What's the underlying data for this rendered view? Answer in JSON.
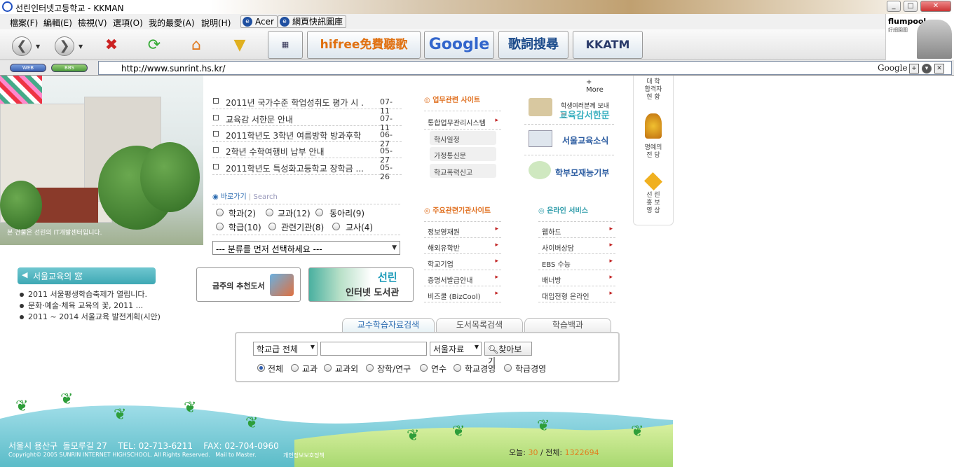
{
  "window": {
    "title": "선린인터넷고등학교 - KKMAN",
    "btn_min": "_",
    "btn_max": "□",
    "btn_close": "✕"
  },
  "menubar": {
    "items": [
      "檔案(F)",
      "編輯(E)",
      "檢視(V)",
      "選項(O)",
      "我的最愛(A)",
      "說明(H)"
    ],
    "favs": [
      "Acer",
      "網頁快訊圖庫"
    ]
  },
  "toolbar": {
    "brands": [
      "hifree免費聽歌",
      "Google",
      "歌詞搜尋",
      "KKATM"
    ]
  },
  "profile": {
    "title": "flumpool",
    "sub": "好細園圍"
  },
  "addressbar": {
    "pill1": "WEB",
    "pill2": "BBS",
    "url": "http://www.sunrint.hs.kr/",
    "search_engine": "Google"
  },
  "campus": {
    "caption": "본 건물은 선린의 IT개발센터입니다."
  },
  "news": {
    "more": "+ More",
    "items": [
      {
        "title": "2011년 국가수준 학업성취도 평가 시 ...",
        "date": "07-11"
      },
      {
        "title": "교육감 서한문 안내",
        "date": "07-11"
      },
      {
        "title": "2011학년도 3학년 여름방학 방과후학 ...",
        "date": "06-27"
      },
      {
        "title": "2학년 수학여행비 납부 안내",
        "date": "05-27"
      },
      {
        "title": "2011학년도 특성화고등학교 장학금 ...",
        "date": "05-26"
      }
    ]
  },
  "shortcut": {
    "label": "바로가기",
    "search": "Search",
    "options": [
      "학과(2)",
      "교과(12)",
      "동아리(9)",
      "학급(10)",
      "관련기관(8)",
      "교사(4)"
    ],
    "select": "--- 분류를 먼저 선택하세요 ---"
  },
  "work": {
    "heading": "업무관련 사이트",
    "main": "통합업무관리시스템",
    "subs": [
      "학사일정",
      "가정통신문",
      "학교폭력신고"
    ]
  },
  "rightlinks": [
    "교육감서한문",
    "서울교육소식",
    "학부모재능기부"
  ],
  "rightlinks_top": "학생여러분께 보내는",
  "agency": {
    "heading": "주요관련기관사이트",
    "items": [
      "정보영재원",
      "해외유학반",
      "학교기업",
      "증명서발급안내",
      "비즈쿨 (BizCool)"
    ]
  },
  "online": {
    "heading": "온라인 서비스",
    "items": [
      "웹하드",
      "사이버상담",
      "EBS 수능",
      "배너방",
      "대입전형 온라인"
    ]
  },
  "sidebar": {
    "top": "대 학\n합격자\n현 황",
    "honor": "명예의\n전 당",
    "promo": "선 린\n홍 보\n영 상"
  },
  "eduwin": {
    "title": "서울교육의 窓",
    "items": [
      "2011 서울평생학습축제가 열립니다.",
      "문화·예술·체육 교육의 꽃, 2011 ...",
      "2011 ~ 2014 서울교육 발전계획(시안)"
    ]
  },
  "banners": {
    "books": "금주의 추천도서",
    "library_top": "선린",
    "library_bottom": "인터넷 도서관"
  },
  "search": {
    "tabs": [
      "교수학습자료검색",
      "도서목록검색",
      "학습백과"
    ],
    "grade": "학교급 전체",
    "source": "서울자료",
    "button": "찾아보기",
    "radios": [
      "전체",
      "교과",
      "교과외",
      "장학/연구",
      "연수",
      "학교경영",
      "학급경영"
    ]
  },
  "footer": {
    "address": "서울시 용산구  돌모루길 27    TEL: 02-713-6211    FAX: 02-704-0960",
    "copyright": "Copyright© 2005 SUNRIN INTERNET HIGHSCHOOL. All Rights Reserved.   Mail to Master.",
    "privacy": "개인정보보호정책",
    "today_label": "오늘:",
    "today": "30",
    "total_label": "/ 전체:",
    "total": "1322694"
  }
}
